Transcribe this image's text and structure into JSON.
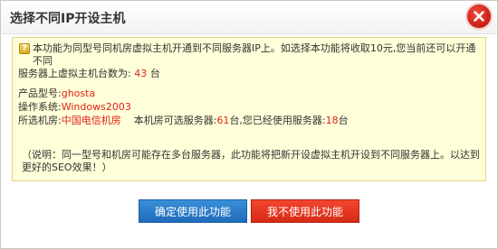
{
  "dialog": {
    "title": "选择不同IP开设主机",
    "close_icon": "close-icon"
  },
  "info": {
    "help_icon": "question-icon",
    "help_glyph": "?",
    "intro_line1": "本功能为同型号同机房虚拟主机开通到不同服务器IP上。如选择本功能将收取10元,您当前还可以开通不同",
    "intro_line2_prefix": "服务器上虚拟主机台数为:",
    "available_count": "43",
    "unit": "台",
    "product_label": "产品型号:",
    "product_value": "ghosta",
    "os_label": "操作系统:",
    "os_value": "Windows2003",
    "room_label": "所选机房:",
    "room_value": "中国电信机房",
    "room_servers_text": "本机房可选服务器:",
    "room_servers_count": "61",
    "used_servers_text": "台,您已经使用服务器:",
    "used_servers_count": "18",
    "note": "（说明：同一型号和机房可能存在多台服务器，此功能将把新开设虚拟主机开设到不同服务器上。以达到更好的SEO效果！）"
  },
  "buttons": {
    "confirm_label": "确定使用此功能",
    "cancel_label": "我不使用此功能"
  },
  "colors": {
    "accent_red": "#e0231a",
    "confirm_blue": "#1f6cbc",
    "cancel_red": "#d62b16",
    "info_bg": "#ffffd9"
  }
}
